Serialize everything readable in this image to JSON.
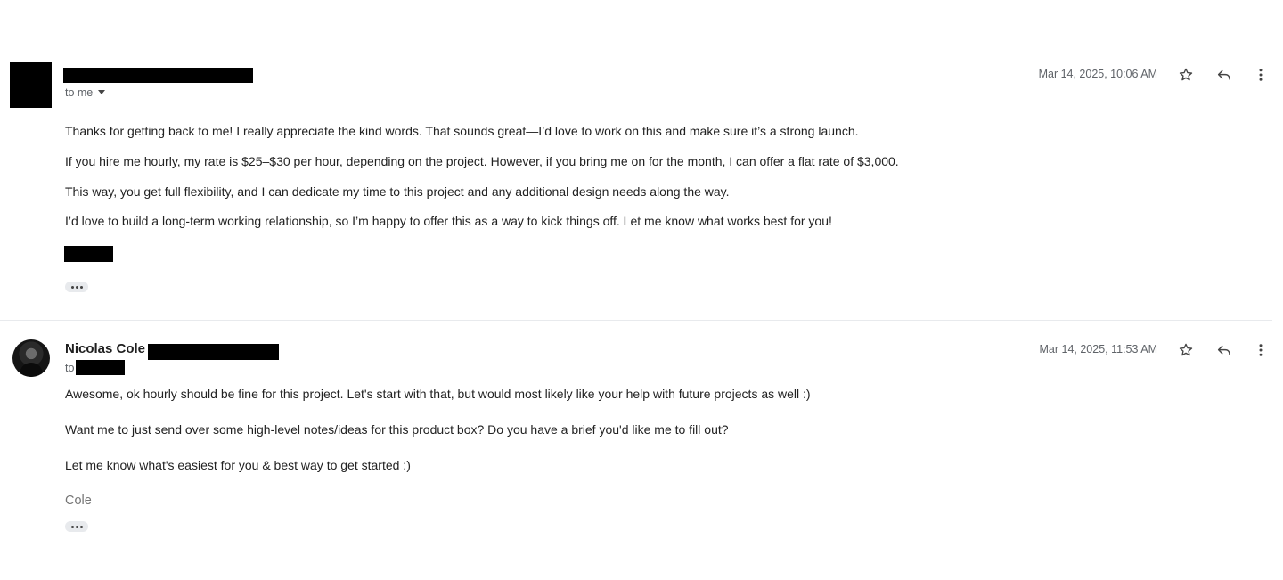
{
  "messages": [
    {
      "sender_name": "",
      "to_label": "to me",
      "timestamp": "Mar 14, 2025, 10:06 AM",
      "body": [
        "Thanks for getting back to me! I really appreciate the kind words. That sounds great—I’d love to work on this and make sure it’s a strong launch.",
        "If you hire me hourly, my rate is $25–$30 per hour, depending on the project. However, if you bring me on for the month, I can offer a flat rate of $3,000.",
        "This way, you get full flexibility, and I can dedicate my time to this project and any additional design needs along the way.",
        "I’d love to build a long-term working relationship, so I’m happy to offer this as a way to kick things off. Let me know what works best for you!"
      ],
      "signature": ""
    },
    {
      "sender_name": "Nicolas Cole",
      "to_label": "to",
      "timestamp": "Mar 14, 2025, 11:53 AM",
      "body": [
        "Awesome, ok hourly should be fine for this project. Let's start with that, but would most likely like your help with future projects as well :)",
        "Want me to just send over some high-level notes/ideas for this product box? Do you have a brief you'd like me to fill out?",
        "Let me know what's easiest for you & best way to get started :)"
      ],
      "signature": "Cole"
    }
  ],
  "icons": {
    "star": "star-icon",
    "reply": "reply-icon",
    "more": "more-vert-icon",
    "expand": "ellipsis-icon",
    "dropdown": "caret-down-icon"
  }
}
